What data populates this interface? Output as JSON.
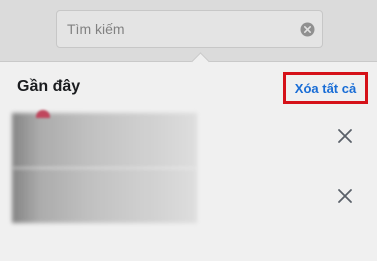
{
  "search": {
    "placeholder": "Tìm kiếm"
  },
  "recent_panel": {
    "title": "Gần đây",
    "clear_all_label": "Xóa tất cả",
    "items": [
      {
        "remove_icon": "close-icon"
      },
      {
        "remove_icon": "close-icon"
      }
    ]
  },
  "colors": {
    "link_blue": "#1b74e4",
    "highlight_red": "#e3131b",
    "title_text": "#1c1e21"
  }
}
